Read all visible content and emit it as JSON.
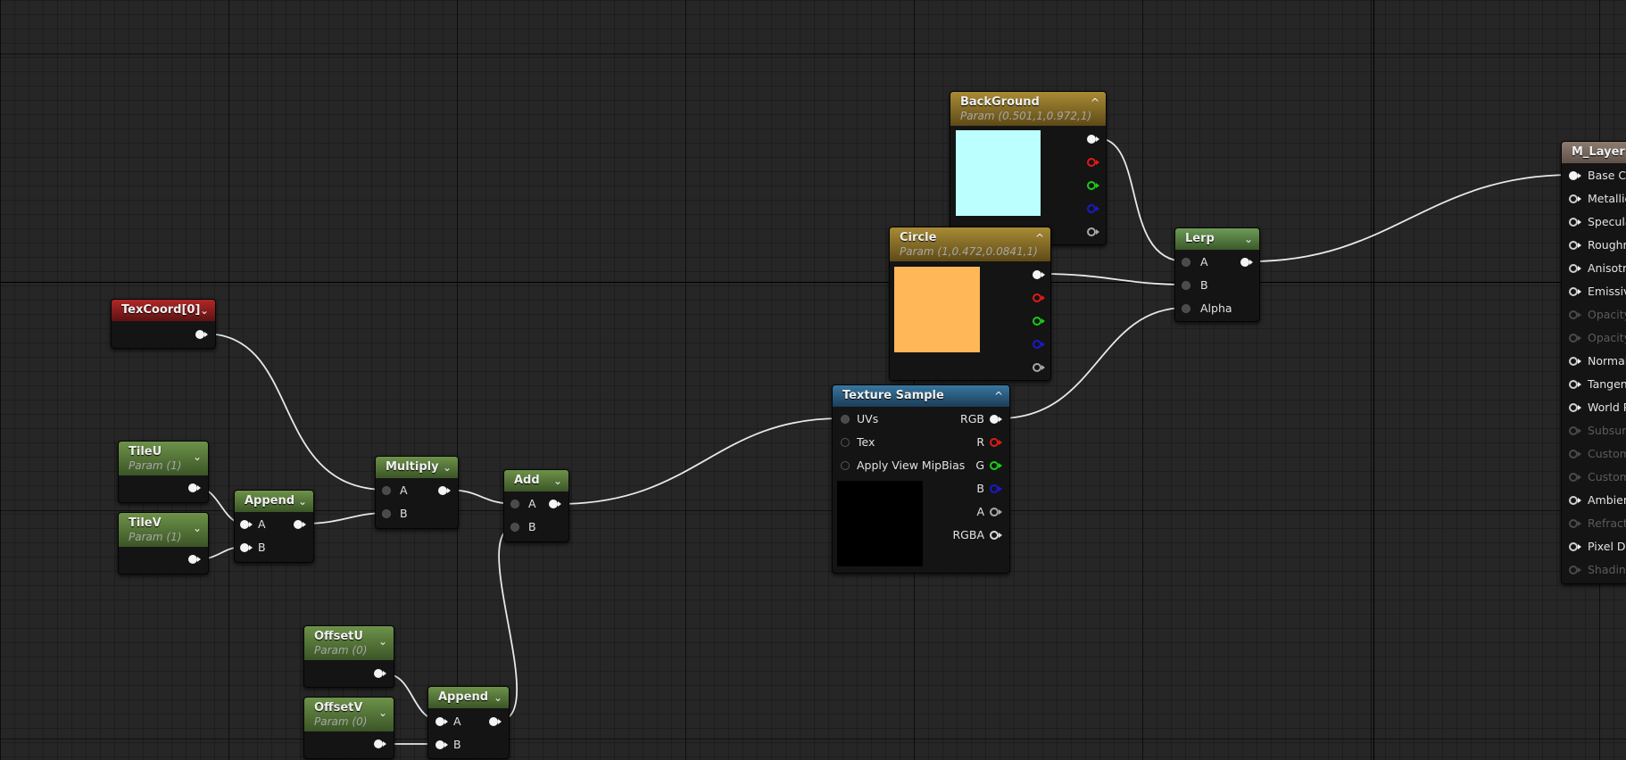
{
  "colors": {
    "background_swatch": "#BBFFFF",
    "circle_swatch": "#FFB757",
    "texture_preview": "#000000",
    "wire": "#E8E8E8"
  },
  "nodes": {
    "background": {
      "title": "BackGround",
      "subtitle": "Param (0.501,1,0.972,1)"
    },
    "circle": {
      "title": "Circle",
      "subtitle": "Param (1,0.472,0.0841,1)"
    },
    "lerp": {
      "title": "Lerp",
      "pins": {
        "a": "A",
        "b": "B",
        "alpha": "Alpha"
      }
    },
    "texcoord": {
      "title": "TexCoord[0]"
    },
    "texture_sample": {
      "title": "Texture Sample",
      "inputs": {
        "uvs": "UVs",
        "tex": "Tex",
        "mipbias": "Apply View MipBias"
      },
      "outputs": {
        "rgb": "RGB",
        "r": "R",
        "g": "G",
        "b": "B",
        "a": "A",
        "rgba": "RGBA"
      }
    },
    "tileu": {
      "title": "TileU",
      "subtitle": "Param (1)"
    },
    "tilev": {
      "title": "TileV",
      "subtitle": "Param (1)"
    },
    "append1": {
      "title": "Append",
      "pins": {
        "a": "A",
        "b": "B"
      }
    },
    "multiply": {
      "title": "Multiply",
      "pins": {
        "a": "A",
        "b": "B"
      }
    },
    "add": {
      "title": "Add",
      "pins": {
        "a": "A",
        "b": "B"
      }
    },
    "offsetu": {
      "title": "OffsetU",
      "subtitle": "Param (0)"
    },
    "offsetv": {
      "title": "OffsetV",
      "subtitle": "Param (0)"
    },
    "append2": {
      "title": "Append",
      "pins": {
        "a": "A",
        "b": "B"
      }
    },
    "m_layer": {
      "title": "M_Layer",
      "inputs": [
        {
          "label": "Base Co",
          "enabled": true
        },
        {
          "label": "Metallic",
          "enabled": true
        },
        {
          "label": "Specula",
          "enabled": true
        },
        {
          "label": "Roughn",
          "enabled": true
        },
        {
          "label": "Anisotr",
          "enabled": true
        },
        {
          "label": "Emissiv",
          "enabled": true
        },
        {
          "label": "Opacity",
          "enabled": false
        },
        {
          "label": "Opacity",
          "enabled": false
        },
        {
          "label": "Normal",
          "enabled": true
        },
        {
          "label": "Tangen",
          "enabled": true
        },
        {
          "label": "World P",
          "enabled": true
        },
        {
          "label": "Subsurf",
          "enabled": false
        },
        {
          "label": "Custom",
          "enabled": false
        },
        {
          "label": "Custom",
          "enabled": false
        },
        {
          "label": "Ambien",
          "enabled": true
        },
        {
          "label": "Refracti",
          "enabled": false
        },
        {
          "label": "Pixel De",
          "enabled": true
        },
        {
          "label": "Shadin",
          "enabled": false
        }
      ]
    }
  }
}
